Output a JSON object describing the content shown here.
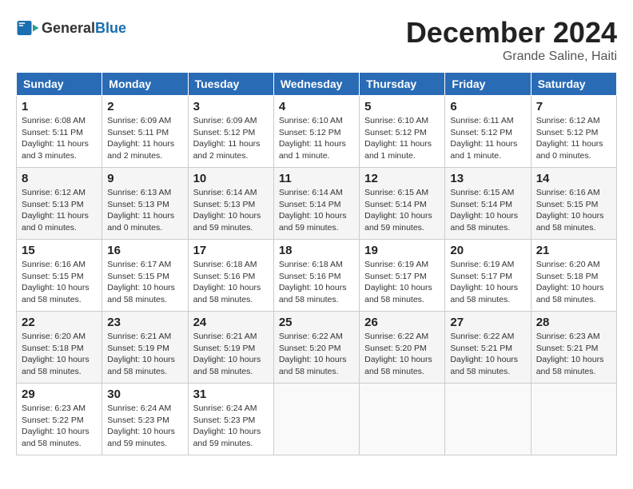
{
  "header": {
    "logo_general": "General",
    "logo_blue": "Blue",
    "month_title": "December 2024",
    "location": "Grande Saline, Haiti"
  },
  "days_of_week": [
    "Sunday",
    "Monday",
    "Tuesday",
    "Wednesday",
    "Thursday",
    "Friday",
    "Saturday"
  ],
  "weeks": [
    [
      {
        "day": "1",
        "sunrise": "6:08 AM",
        "sunset": "5:11 PM",
        "daylight": "11 hours and 3 minutes."
      },
      {
        "day": "2",
        "sunrise": "6:09 AM",
        "sunset": "5:11 PM",
        "daylight": "11 hours and 2 minutes."
      },
      {
        "day": "3",
        "sunrise": "6:09 AM",
        "sunset": "5:12 PM",
        "daylight": "11 hours and 2 minutes."
      },
      {
        "day": "4",
        "sunrise": "6:10 AM",
        "sunset": "5:12 PM",
        "daylight": "11 hours and 1 minute."
      },
      {
        "day": "5",
        "sunrise": "6:10 AM",
        "sunset": "5:12 PM",
        "daylight": "11 hours and 1 minute."
      },
      {
        "day": "6",
        "sunrise": "6:11 AM",
        "sunset": "5:12 PM",
        "daylight": "11 hours and 1 minute."
      },
      {
        "day": "7",
        "sunrise": "6:12 AM",
        "sunset": "5:12 PM",
        "daylight": "11 hours and 0 minutes."
      }
    ],
    [
      {
        "day": "8",
        "sunrise": "6:12 AM",
        "sunset": "5:13 PM",
        "daylight": "11 hours and 0 minutes."
      },
      {
        "day": "9",
        "sunrise": "6:13 AM",
        "sunset": "5:13 PM",
        "daylight": "11 hours and 0 minutes."
      },
      {
        "day": "10",
        "sunrise": "6:14 AM",
        "sunset": "5:13 PM",
        "daylight": "10 hours and 59 minutes."
      },
      {
        "day": "11",
        "sunrise": "6:14 AM",
        "sunset": "5:14 PM",
        "daylight": "10 hours and 59 minutes."
      },
      {
        "day": "12",
        "sunrise": "6:15 AM",
        "sunset": "5:14 PM",
        "daylight": "10 hours and 59 minutes."
      },
      {
        "day": "13",
        "sunrise": "6:15 AM",
        "sunset": "5:14 PM",
        "daylight": "10 hours and 58 minutes."
      },
      {
        "day": "14",
        "sunrise": "6:16 AM",
        "sunset": "5:15 PM",
        "daylight": "10 hours and 58 minutes."
      }
    ],
    [
      {
        "day": "15",
        "sunrise": "6:16 AM",
        "sunset": "5:15 PM",
        "daylight": "10 hours and 58 minutes."
      },
      {
        "day": "16",
        "sunrise": "6:17 AM",
        "sunset": "5:15 PM",
        "daylight": "10 hours and 58 minutes."
      },
      {
        "day": "17",
        "sunrise": "6:18 AM",
        "sunset": "5:16 PM",
        "daylight": "10 hours and 58 minutes."
      },
      {
        "day": "18",
        "sunrise": "6:18 AM",
        "sunset": "5:16 PM",
        "daylight": "10 hours and 58 minutes."
      },
      {
        "day": "19",
        "sunrise": "6:19 AM",
        "sunset": "5:17 PM",
        "daylight": "10 hours and 58 minutes."
      },
      {
        "day": "20",
        "sunrise": "6:19 AM",
        "sunset": "5:17 PM",
        "daylight": "10 hours and 58 minutes."
      },
      {
        "day": "21",
        "sunrise": "6:20 AM",
        "sunset": "5:18 PM",
        "daylight": "10 hours and 58 minutes."
      }
    ],
    [
      {
        "day": "22",
        "sunrise": "6:20 AM",
        "sunset": "5:18 PM",
        "daylight": "10 hours and 58 minutes."
      },
      {
        "day": "23",
        "sunrise": "6:21 AM",
        "sunset": "5:19 PM",
        "daylight": "10 hours and 58 minutes."
      },
      {
        "day": "24",
        "sunrise": "6:21 AM",
        "sunset": "5:19 PM",
        "daylight": "10 hours and 58 minutes."
      },
      {
        "day": "25",
        "sunrise": "6:22 AM",
        "sunset": "5:20 PM",
        "daylight": "10 hours and 58 minutes."
      },
      {
        "day": "26",
        "sunrise": "6:22 AM",
        "sunset": "5:20 PM",
        "daylight": "10 hours and 58 minutes."
      },
      {
        "day": "27",
        "sunrise": "6:22 AM",
        "sunset": "5:21 PM",
        "daylight": "10 hours and 58 minutes."
      },
      {
        "day": "28",
        "sunrise": "6:23 AM",
        "sunset": "5:21 PM",
        "daylight": "10 hours and 58 minutes."
      }
    ],
    [
      {
        "day": "29",
        "sunrise": "6:23 AM",
        "sunset": "5:22 PM",
        "daylight": "10 hours and 58 minutes."
      },
      {
        "day": "30",
        "sunrise": "6:24 AM",
        "sunset": "5:23 PM",
        "daylight": "10 hours and 59 minutes."
      },
      {
        "day": "31",
        "sunrise": "6:24 AM",
        "sunset": "5:23 PM",
        "daylight": "10 hours and 59 minutes."
      },
      null,
      null,
      null,
      null
    ]
  ],
  "labels": {
    "sunrise": "Sunrise:",
    "sunset": "Sunset:",
    "daylight": "Daylight:"
  }
}
